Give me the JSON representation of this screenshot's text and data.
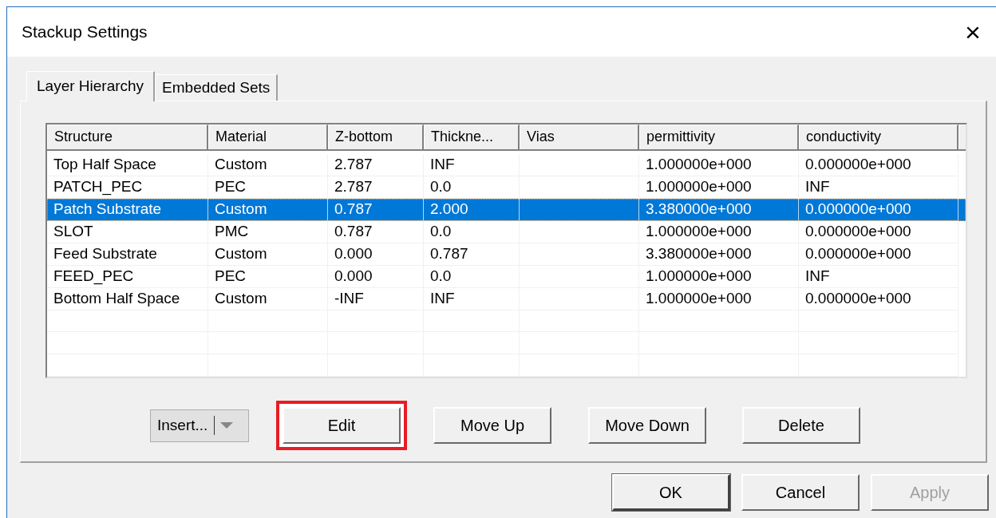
{
  "window": {
    "title": "Stackup Settings",
    "close": "×"
  },
  "tabs": [
    {
      "label": "Layer Hierarchy",
      "selected": true
    },
    {
      "label": "Embedded Sets",
      "selected": false
    }
  ],
  "table": {
    "columns": [
      "Structure",
      "Material",
      "Z-bottom",
      "Thickne...",
      "Vias",
      "permittivity",
      "conductivity"
    ],
    "rows": [
      {
        "cells": [
          "Top Half Space",
          "Custom",
          "2.787",
          "INF",
          "",
          "1.000000e+000",
          "0.000000e+000"
        ],
        "selected": false
      },
      {
        "cells": [
          "PATCH_PEC",
          "PEC",
          "2.787",
          "0.0",
          "",
          "1.000000e+000",
          "INF"
        ],
        "selected": false
      },
      {
        "cells": [
          "Patch Substrate",
          "Custom",
          "0.787",
          "2.000",
          "",
          "3.380000e+000",
          "0.000000e+000"
        ],
        "selected": true
      },
      {
        "cells": [
          "SLOT",
          "PMC",
          "0.787",
          "0.0",
          "",
          "1.000000e+000",
          "0.000000e+000"
        ],
        "selected": false
      },
      {
        "cells": [
          "Feed Substrate",
          "Custom",
          "0.000",
          "0.787",
          "",
          "3.380000e+000",
          "0.000000e+000"
        ],
        "selected": false
      },
      {
        "cells": [
          "FEED_PEC",
          "PEC",
          "0.000",
          "0.0",
          "",
          "1.000000e+000",
          "INF"
        ],
        "selected": false
      },
      {
        "cells": [
          "Bottom Half Space",
          "Custom",
          "-INF",
          "INF",
          "",
          "1.000000e+000",
          "0.000000e+000"
        ],
        "selected": false
      }
    ]
  },
  "insert_dropdown": {
    "label": "Insert...",
    "disabled": true
  },
  "actions": [
    {
      "label": "Edit",
      "highlighted": true
    },
    {
      "label": "Move Up",
      "highlighted": false
    },
    {
      "label": "Move Down",
      "highlighted": false
    },
    {
      "label": "Delete",
      "highlighted": false
    }
  ],
  "dialog_buttons": [
    {
      "label": "OK",
      "disabled": false,
      "default": true
    },
    {
      "label": "Cancel",
      "disabled": false,
      "default": false
    },
    {
      "label": "Apply",
      "disabled": true,
      "default": false
    }
  ]
}
